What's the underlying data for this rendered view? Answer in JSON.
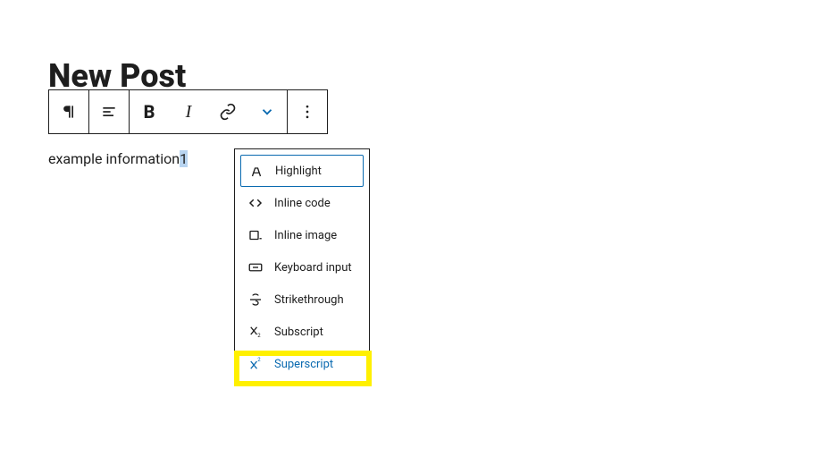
{
  "post": {
    "title": "New Post",
    "content_text": "example information",
    "selected_text": "1"
  },
  "toolbar": {
    "paragraph_tool": "Paragraph",
    "align_tool": "Align",
    "bold_label": "B",
    "italic_label": "I",
    "link_tool": "Link",
    "more_tool": "More",
    "options_tool": "Options"
  },
  "dropdown": {
    "items": [
      {
        "label": "Highlight",
        "icon": "highlight"
      },
      {
        "label": "Inline code",
        "icon": "code"
      },
      {
        "label": "Inline image",
        "icon": "image"
      },
      {
        "label": "Keyboard input",
        "icon": "keyboard"
      },
      {
        "label": "Strikethrough",
        "icon": "strike"
      },
      {
        "label": "Subscript",
        "icon": "subscript"
      },
      {
        "label": "Superscript",
        "icon": "superscript"
      }
    ]
  },
  "colors": {
    "accent": "#0a6ab0",
    "highlight": "#fff000"
  }
}
